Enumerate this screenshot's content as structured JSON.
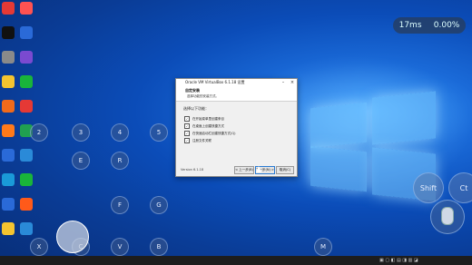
{
  "hud": {
    "latency": "17ms",
    "loss": "0.00%"
  },
  "desktop_icons": [
    {
      "label": "",
      "color": "#e53935"
    },
    {
      "label": "",
      "color": "#ff5252"
    },
    {
      "label": "",
      "color": "#111111"
    },
    {
      "label": "",
      "color": "#2a6ad8"
    },
    {
      "label": "",
      "color": "#8a8a8a"
    },
    {
      "label": "",
      "color": "#7a4ad0"
    },
    {
      "label": "",
      "color": "#f4c430"
    },
    {
      "label": "",
      "color": "#19b43a"
    },
    {
      "label": "",
      "color": "#f06a1a"
    },
    {
      "label": "",
      "color": "#e53935"
    },
    {
      "label": "",
      "color": "#ff7a1a"
    },
    {
      "label": "",
      "color": "#20a050"
    },
    {
      "label": "",
      "color": "#2a6ad8"
    },
    {
      "label": "",
      "color": "#2a8ad8"
    },
    {
      "label": "",
      "color": "#1a9ad8"
    },
    {
      "label": "",
      "color": "#19b43a"
    },
    {
      "label": "",
      "color": "#2a6ad8"
    },
    {
      "label": "",
      "color": "#ff5a1a"
    },
    {
      "label": "",
      "color": "#f4c430"
    },
    {
      "label": "",
      "color": "#2a8ad8"
    }
  ],
  "keys": {
    "k2": "2",
    "k3": "3",
    "k4": "4",
    "k5": "5",
    "kE": "E",
    "kR": "R",
    "kF": "F",
    "kG": "G",
    "kX": "X",
    "kC": "C",
    "kV": "V",
    "kB": "B",
    "kM": "M",
    "shift": "Shift",
    "ctrl": "Ct"
  },
  "dialog": {
    "title": "Oracle VM VirtualBox 6.1.18 设置",
    "header": "自定安装",
    "subheader": "选择功能的安装方式。",
    "group_label": "选择以下功能：",
    "options": [
      {
        "label": "在开始菜单里创建条目",
        "checked": true
      },
      {
        "label": "在桌面上创建快捷方式",
        "checked": true
      },
      {
        "label": "在快速启动栏创建快捷方式(Q)",
        "checked": true
      },
      {
        "label": "注册文件关联",
        "checked": true
      }
    ],
    "version": "Version 6.1.18",
    "buttons": {
      "back": "< 上一步(B)",
      "next": "下一步(N) >",
      "cancel": "取消(C)"
    }
  },
  "colors": {
    "desktop_bg": "#0a4aa8",
    "dialog_bg": "#f0f0f0",
    "taskbar": "#1d1d1d"
  }
}
